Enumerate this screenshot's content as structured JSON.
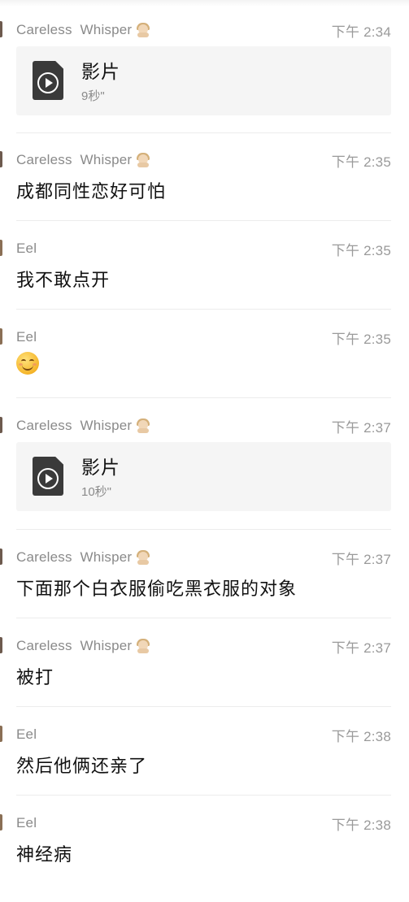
{
  "colors": {
    "background": "#ffffff",
    "sender_text": "#8a8a8a",
    "time_text": "#9a9a9a",
    "message_text": "#111111",
    "card_background": "#f5f5f5",
    "divider": "#ececec"
  },
  "messages": [
    {
      "sender_first": "Careless",
      "sender_second": "Whisper",
      "sender_emoji": "praying-girl-emoji",
      "time": "下午 2:34",
      "type": "video",
      "video": {
        "title": "影片",
        "duration": "9秒\""
      }
    },
    {
      "sender_first": "Careless",
      "sender_second": "Whisper",
      "sender_emoji": "praying-girl-emoji",
      "time": "下午 2:35",
      "type": "text",
      "text": "成都同性恋好可怕"
    },
    {
      "sender_first": "Eel",
      "time": "下午 2:35",
      "type": "text",
      "text": "我不敢点开"
    },
    {
      "sender_first": "Eel",
      "time": "下午 2:35",
      "type": "emoji",
      "emoji": "smiling-face-icon"
    },
    {
      "sender_first": "Careless",
      "sender_second": "Whisper",
      "sender_emoji": "praying-girl-emoji",
      "time": "下午 2:37",
      "type": "video",
      "video": {
        "title": "影片",
        "duration": "10秒\""
      }
    },
    {
      "sender_first": "Careless",
      "sender_second": "Whisper",
      "sender_emoji": "praying-girl-emoji",
      "time": "下午 2:37",
      "type": "text",
      "text": "下面那个白衣服偷吃黑衣服的对象"
    },
    {
      "sender_first": "Careless",
      "sender_second": "Whisper",
      "sender_emoji": "praying-girl-emoji",
      "time": "下午 2:37",
      "type": "text",
      "text": "被打"
    },
    {
      "sender_first": "Eel",
      "time": "下午 2:38",
      "type": "text",
      "text": "然后他俩还亲了"
    },
    {
      "sender_first": "Eel",
      "time": "下午 2:38",
      "type": "text",
      "text": "神经病"
    }
  ]
}
